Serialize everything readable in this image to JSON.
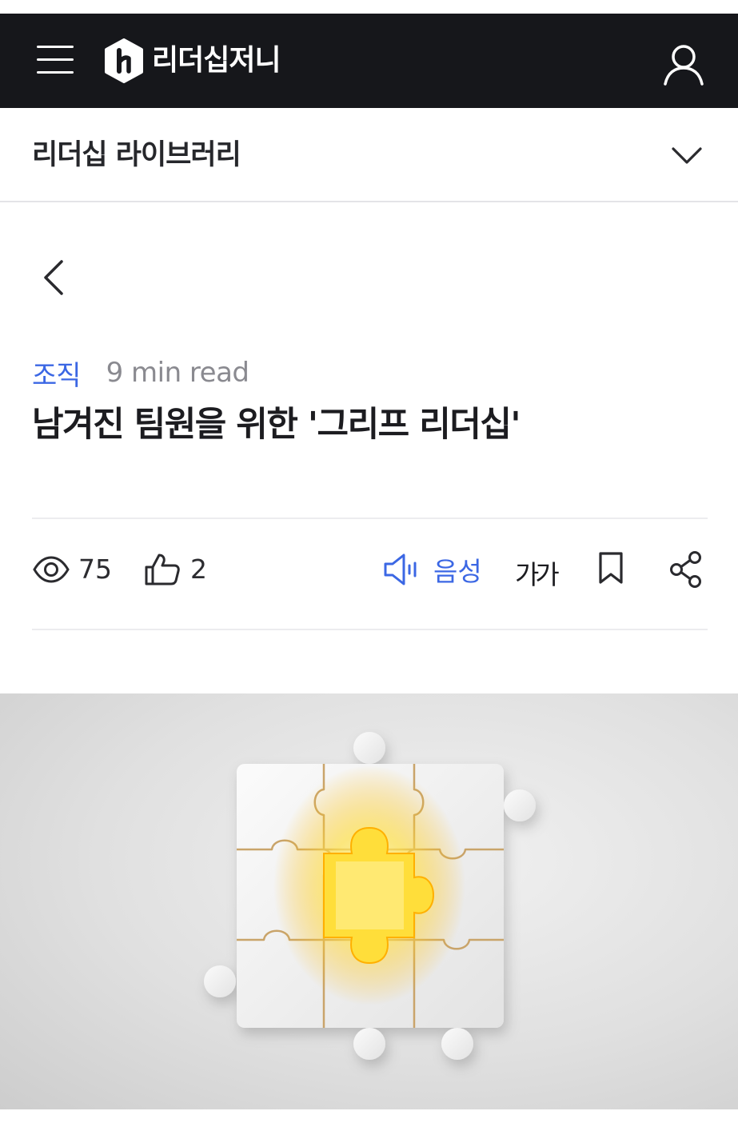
{
  "header": {
    "logo_text": "리더십저니",
    "logo_icon": "li-logo-icon",
    "menu_icon": "hamburger-menu-icon",
    "user_icon": "user-icon"
  },
  "category_bar": {
    "title": "리더십 라이브러리",
    "toggle_icon": "chevron-down-icon"
  },
  "article": {
    "back_icon": "chevron-left-icon",
    "category": "조직",
    "read_time": "9 min read",
    "title": "남겨진 팀원을 위한 '그리프 리더십'",
    "stats": {
      "views": "75",
      "likes": "2"
    },
    "actions": {
      "voice_label": "음성",
      "font_size_label": "가가",
      "bookmark_icon": "bookmark-icon",
      "share_icon": "share-icon"
    },
    "hero_image": "puzzle-pieces-with-glowing-center-piece"
  },
  "colors": {
    "header_bg": "#16171b",
    "accent": "#3b67e4",
    "glow": "#ffd23c"
  }
}
